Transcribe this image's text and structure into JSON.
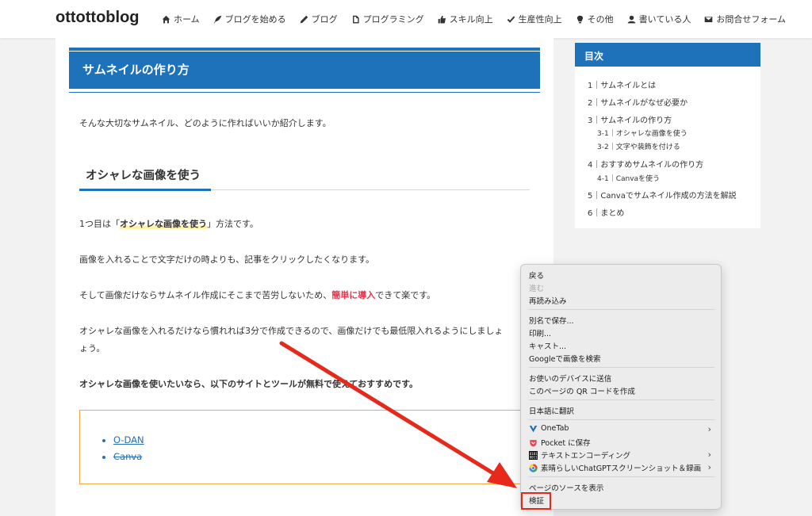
{
  "header": {
    "logo": "ottottoblog",
    "nav": [
      {
        "label": "ホーム",
        "icon": "home-icon"
      },
      {
        "label": "ブログを始める",
        "icon": "feather-icon"
      },
      {
        "label": "ブログ",
        "icon": "pen-icon"
      },
      {
        "label": "プログラミング",
        "icon": "document-icon"
      },
      {
        "label": "スキル向上",
        "icon": "thumbs-up-icon"
      },
      {
        "label": "生産性向上",
        "icon": "check-icon"
      },
      {
        "label": "その他",
        "icon": "lightbulb-icon"
      },
      {
        "label": "書いている人",
        "icon": "user-icon"
      },
      {
        "label": "お問合せフォーム",
        "icon": "mail-icon"
      }
    ]
  },
  "article": {
    "h2": "サムネイルの作り方",
    "p1": "そんな大切なサムネイル、どのように作ればいいか紹介します。",
    "h3": "オシャレな画像を使う",
    "p2_pre": "1つ目は「",
    "p2_mark": "オシャレな画像を使う",
    "p2_post": "」方法です。",
    "p3": "画像を入れることで文字だけの時よりも、記事をクリックしたくなります。",
    "p4_pre": "そして画像だけならサムネイル作成にそこまで苦労しないため、",
    "p4_red": "簡単に導入",
    "p4_post": "できて楽です。",
    "p5_line1": "オシャレな画像を入れるだけなら慣れれば3分で作成できるので、画像だけでも最低限入れるようにしましょ",
    "p5_line2": "ょう。",
    "p6": "オシャレな画像を使いたいなら、以下のサイトとツールが無料で使えておすすめです。",
    "links": [
      "O-DAN",
      "Canva"
    ]
  },
  "toc": {
    "title": "目次",
    "items": [
      "1｜サムネイルとは",
      "2｜サムネイルがなぜ必要か",
      "3｜サムネイルの作り方",
      "3-1｜オシャレな画像を使う",
      "3-2｜文字や装飾を付ける",
      "4｜おすすめサムネイルの作り方",
      "4-1｜Canvaを使う",
      "5｜Canvaでサムネイル作成の方法を解説",
      "6｜まとめ"
    ]
  },
  "context_menu": {
    "back": "戻る",
    "forward": "進む",
    "reload": "再読み込み",
    "save_as": "別名で保存...",
    "print": "印刷...",
    "cast": "キャスト...",
    "search_image": "Googleで画像を検索",
    "send_device": "お使いのデバイスに送信",
    "qr_code": "このページの QR コードを作成",
    "translate": "日本語に翻訳",
    "onetab": "OneTab",
    "pocket": "Pocket に保存",
    "text_encoding": "テキストエンコーディング",
    "chatgpt_shot": "素晴らしいChatGPTスクリーンショット＆録画",
    "view_source": "ページのソースを表示",
    "inspect": "検証"
  },
  "colors": {
    "accent": "#1e72b9",
    "highlight_red": "#e6291b",
    "link": "#2a6fb3"
  }
}
